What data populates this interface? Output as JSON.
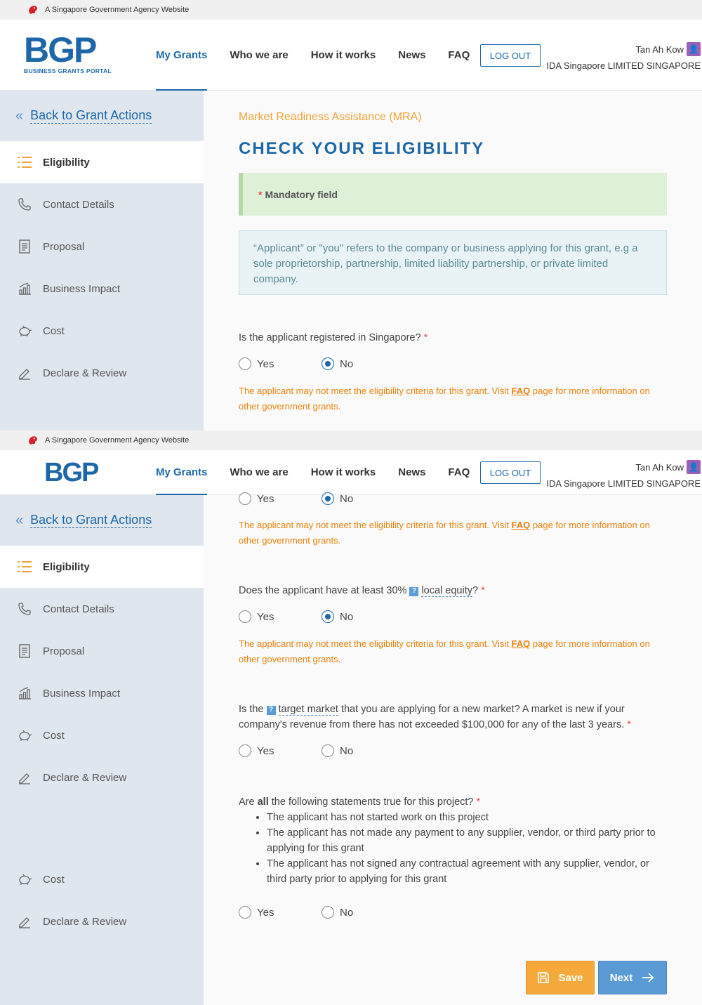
{
  "gov_bar": {
    "text": "A Singapore Government Agency Website"
  },
  "logo": {
    "mark": "BGP",
    "subtitle": "BUSINESS GRANTS PORTAL"
  },
  "nav": [
    "My Grants",
    "Who we are",
    "How it works",
    "News",
    "FAQ"
  ],
  "logout": "LOG OUT",
  "user": {
    "name": "Tan Ah Kow",
    "company": "IDA Singapore LIMITED SINGAPORE"
  },
  "sidebar": {
    "back": "Back to Grant Actions",
    "items": [
      "Eligibility",
      "Contact Details",
      "Proposal",
      "Business Impact",
      "Cost",
      "Declare & Review"
    ],
    "extra_items": [
      "Cost",
      "Declare & Review"
    ]
  },
  "page": {
    "grant_name": "Market Readiness Assistance (MRA)",
    "title": "CHECK YOUR ELIGIBILITY",
    "mandatory": "Mandatory field",
    "info": "“Applicant” or \"you\" refers to the company or business applying for this grant, e.g a sole proprietorship, partnership, limited liability partnership, or private limited company."
  },
  "questions": {
    "q1": "Is the applicant registered in Singapore?",
    "q2_pre": "Does the applicant have at least 30%",
    "q2_term": "local equity",
    "q2_post": "?",
    "q3_pre": "Is the",
    "q3_term": "target market",
    "q3_post": "that you are applying for a new market? A market is new if your company's revenue from there has not exceeded $100,000 for any of the last 3 years.",
    "q4_pre": "Are",
    "q4_bold": "all",
    "q4_post": "the following statements true for this project?",
    "q4_bullets": [
      "The applicant has not started work on this project",
      "The applicant has not made any payment to any supplier, vendor, or third party prior to applying for this grant",
      "The applicant has not signed any contractual agreement with any supplier, vendor, or third party prior to applying for this grant"
    ],
    "yes": "Yes",
    "no": "No",
    "required_mark": "*"
  },
  "warning": {
    "pre": "The applicant may not meet the eligibility criteria for this grant. Visit",
    "link": "FAQ",
    "post": "page for more information on other government grants."
  },
  "buttons": {
    "save": "Save",
    "next": "Next"
  },
  "colors": {
    "brand": "#1d67a8",
    "accent": "#f0a33a",
    "warning": "#e8810d",
    "required": "#d9534f"
  }
}
